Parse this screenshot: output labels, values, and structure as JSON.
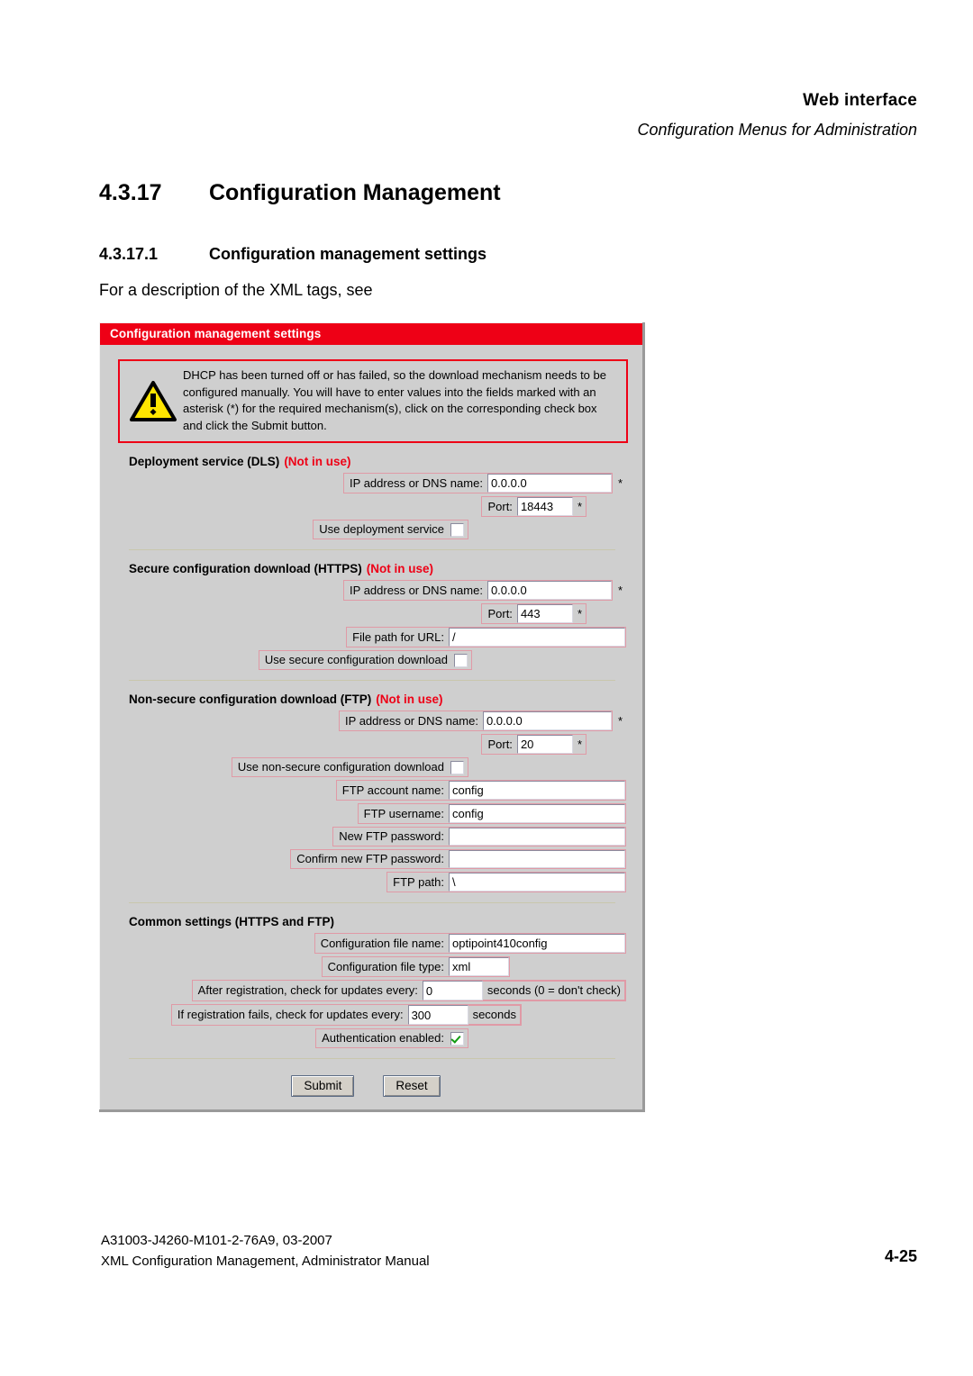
{
  "header": {
    "title": "Web interface",
    "subtitle": "Configuration Menus for Administration"
  },
  "headings": {
    "h1_number": "4.3.17",
    "h1_text": "Configuration Management",
    "h2_number": "4.3.17.1",
    "h2_text": "Configuration management settings",
    "body_line": "For a description of the XML tags, see"
  },
  "panel": {
    "title": "Configuration management settings",
    "warning": {
      "icon": "warning-triangle-icon",
      "text": "DHCP has been turned off or has failed, so the download mechanism needs to be configured manually. You will have to enter values into the fields marked with an asterisk (*) for the required mechanism(s), click on the corresponding check box and click the Submit button."
    },
    "not_in_use_label": "(Not in use)",
    "required_marker": "*",
    "sections": [
      {
        "id": "dls",
        "title": "Deployment service (DLS)",
        "status": "(Not in use)",
        "fields": {
          "ip_label": "IP address or DNS name:",
          "ip_value": "0.0.0.0",
          "port_label": "Port:",
          "port_value": "18443",
          "use_label": "Use deployment service",
          "use_checked": false
        }
      },
      {
        "id": "https",
        "title": "Secure configuration download (HTTPS)",
        "status": "(Not in use)",
        "fields": {
          "ip_label": "IP address or DNS name:",
          "ip_value": "0.0.0.0",
          "port_label": "Port:",
          "port_value": "443",
          "path_label": "File path for URL:",
          "path_value": "/",
          "use_label": "Use secure configuration download",
          "use_checked": false
        }
      },
      {
        "id": "ftp",
        "title": "Non-secure configuration download (FTP)",
        "status": "(Not in use)",
        "fields": {
          "ip_label": "IP address or DNS name:",
          "ip_value": "0.0.0.0",
          "port_label": "Port:",
          "port_value": "20",
          "use_label": "Use non-secure configuration download",
          "use_checked": false,
          "account_label": "FTP account name:",
          "account_value": "config",
          "username_label": "FTP username:",
          "username_value": "config",
          "newpass_label": "New FTP password:",
          "newpass_value": "",
          "confirmpass_label": "Confirm new FTP password:",
          "confirmpass_value": "",
          "path_label": "FTP path:",
          "path_value": "\\"
        }
      },
      {
        "id": "common",
        "title": "Common settings (HTTPS and FTP)",
        "status": "",
        "fields": {
          "filename_label": "Configuration file name:",
          "filename_value": "optipoint410config",
          "filetype_label": "Configuration file type:",
          "filetype_value": "xml",
          "after_reg_label": "After registration, check for updates every:",
          "after_reg_value": "0",
          "after_reg_unit": "seconds (0 = don't check)",
          "fail_reg_label": "If registration fails, check for updates every:",
          "fail_reg_value": "300",
          "fail_reg_unit": "seconds",
          "auth_label": "Authentication enabled:",
          "auth_checked": true
        }
      }
    ],
    "buttons": {
      "submit": "Submit",
      "reset": "Reset"
    }
  },
  "footer": {
    "line1": "A31003-J4260-M101-2-76A9, 03-2007",
    "line2": "XML Configuration Management, Administrator Manual",
    "page": "4-25"
  },
  "colors": {
    "accent_red": "#ee0016",
    "panel_gray": "#cfcfcf",
    "field_border_pink": "#e09aa6",
    "check_green": "#139c13",
    "warning_yellow": "#ffe500"
  }
}
